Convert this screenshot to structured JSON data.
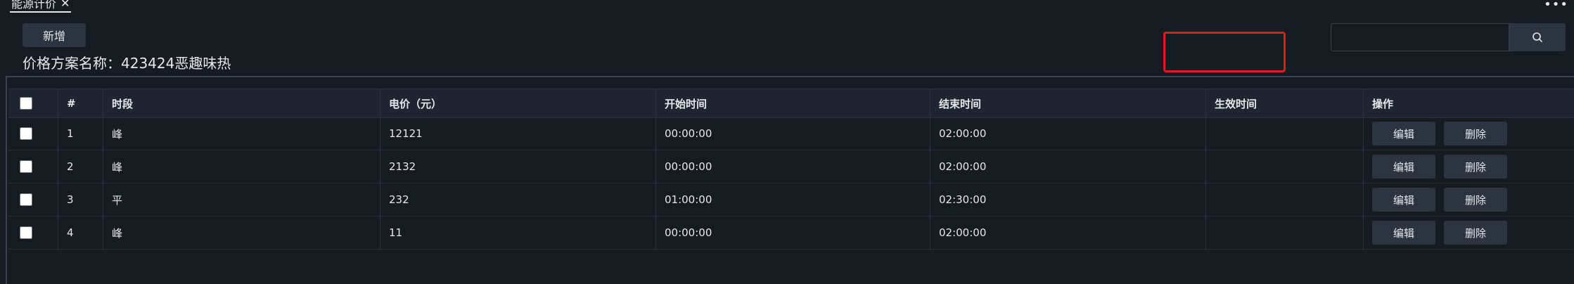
{
  "tab": {
    "label": "能源计价",
    "close": "✕"
  },
  "more_label": "•••",
  "toolbar": {
    "add_label": "新增"
  },
  "scheme": {
    "label": "价格方案名称：",
    "value": "423424恶趣味热"
  },
  "search": {
    "value": "",
    "placeholder": ""
  },
  "table": {
    "headers": {
      "select": "",
      "index": "#",
      "period": "时段",
      "price": "电价（元）",
      "start": "开始时间",
      "end": "结束时间",
      "effective": "生效时间",
      "ops": "操作"
    },
    "rows": [
      {
        "index": "1",
        "period": "峰",
        "price": "12121",
        "start": "00:00:00",
        "end": "02:00:00",
        "effective": "",
        "edit": "编辑",
        "delete": "删除"
      },
      {
        "index": "2",
        "period": "峰",
        "price": "2132",
        "start": "00:00:00",
        "end": "02:00:00",
        "effective": "",
        "edit": "编辑",
        "delete": "删除"
      },
      {
        "index": "3",
        "period": "平",
        "price": "232",
        "start": "01:00:00",
        "end": "02:30:00",
        "effective": "",
        "edit": "编辑",
        "delete": "删除"
      },
      {
        "index": "4",
        "period": "峰",
        "price": "11",
        "start": "00:00:00",
        "end": "02:00:00",
        "effective": "",
        "edit": "编辑",
        "delete": "删除"
      }
    ]
  },
  "colors": {
    "background": "#161a21",
    "header": "#1e2530",
    "button": "#2c3440",
    "highlight": "#e11b1b"
  },
  "icons": {
    "search": "search-icon",
    "close": "close-icon",
    "more": "more-icon"
  }
}
